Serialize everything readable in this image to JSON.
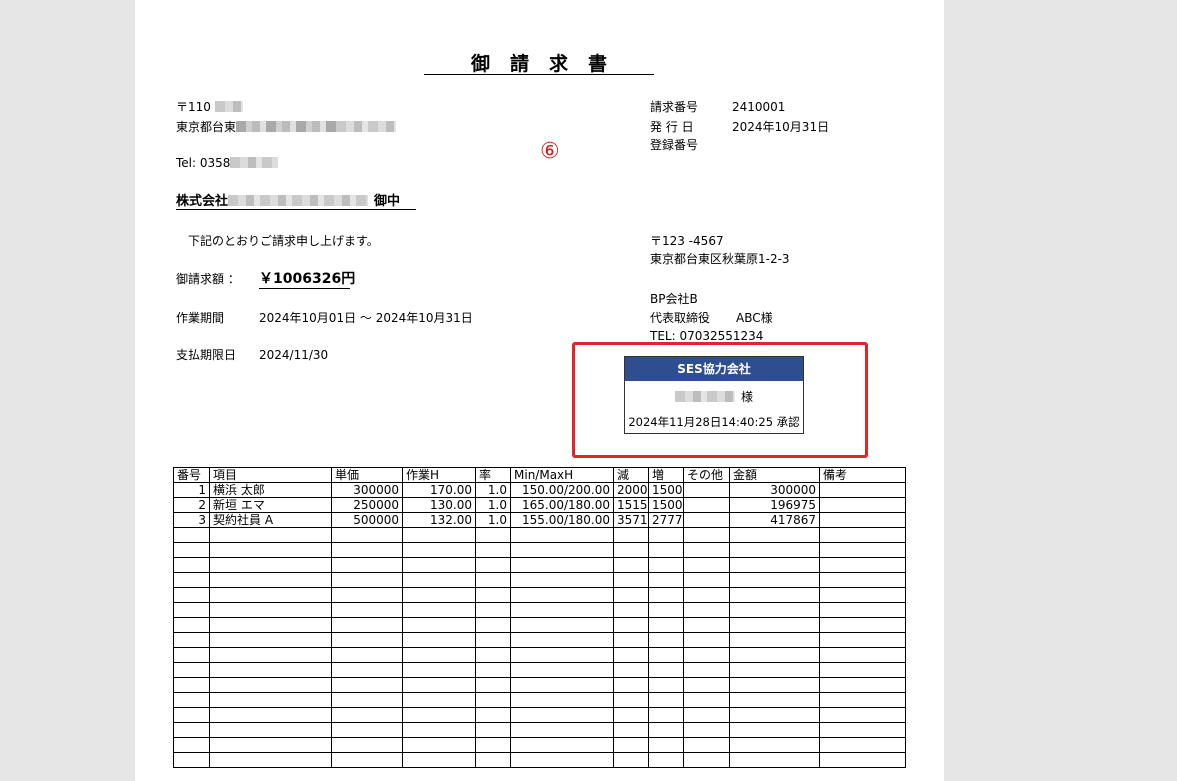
{
  "title": "御請求書",
  "sender": {
    "postal": "〒110",
    "address": "東京都台東",
    "tel": "Tel: 0358"
  },
  "client": {
    "name_prefix": "株式会社",
    "honorific": "御中"
  },
  "intro": "下記のとおりご請求申し上げます。",
  "amount": {
    "label": "御請求額 ：",
    "value": "￥1006326円"
  },
  "period": {
    "label": "作業期間",
    "value": "2024年10月01日 ～ 2024年10月31日"
  },
  "due": {
    "label": "支払期限日",
    "value": "2024/11/30"
  },
  "meta": {
    "invoice_no_label": "請求番号",
    "invoice_no": "2410001",
    "issue_label": "発 行 日",
    "issue_date": "2024年10月31日",
    "reg_label": "登録番号"
  },
  "marker": "⑥",
  "recipient": {
    "postal": "〒123 -4567",
    "address": "東京都台東区秋葉原1-2-3",
    "company": "BP会社B",
    "rep_title": "代表取締役",
    "rep_name": "ABC様",
    "tel": "TEL: 07032551234"
  },
  "stamp": {
    "company": "SES協力会社",
    "suffix": "様",
    "approval": "2024年11月28日14:40:25 承認"
  },
  "table": {
    "headers": [
      "番号",
      "項目",
      "単価",
      "作業H",
      "率",
      "Min/MaxH",
      "減",
      "増",
      "その他",
      "金額",
      "備考"
    ],
    "rows": [
      [
        "1",
        "横浜 太郎",
        "300000",
        "170.00",
        "1.0",
        "150.00/200.00",
        "2000",
        "1500",
        "",
        "300000",
        ""
      ],
      [
        "2",
        "新垣 エマ",
        "250000",
        "130.00",
        "1.0",
        "165.00/180.00",
        "1515",
        "1500",
        "",
        "196975",
        ""
      ],
      [
        "3",
        "契約社員 A",
        "500000",
        "132.00",
        "1.0",
        "155.00/180.00",
        "3571",
        "2777",
        "",
        "417867",
        ""
      ]
    ]
  },
  "colors": {
    "stamp_header": "#2f4e8f",
    "highlight_border": "#e0262a",
    "marker": "#d42020"
  }
}
